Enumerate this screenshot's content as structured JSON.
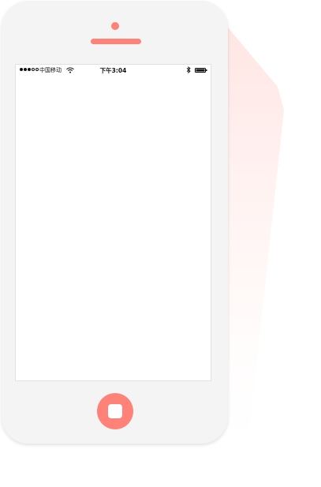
{
  "colors": {
    "accent": "#ff8278",
    "phone_body": "#f4f4f4",
    "screen": "#ffffff"
  },
  "status_bar": {
    "signal_dots_filled": 3,
    "signal_dots_total": 5,
    "carrier": "中国移动",
    "time": "下午3:04",
    "icons": [
      "wifi-icon",
      "bluetooth-icon",
      "battery-icon"
    ]
  },
  "home_button": {
    "icon": "square-icon"
  }
}
